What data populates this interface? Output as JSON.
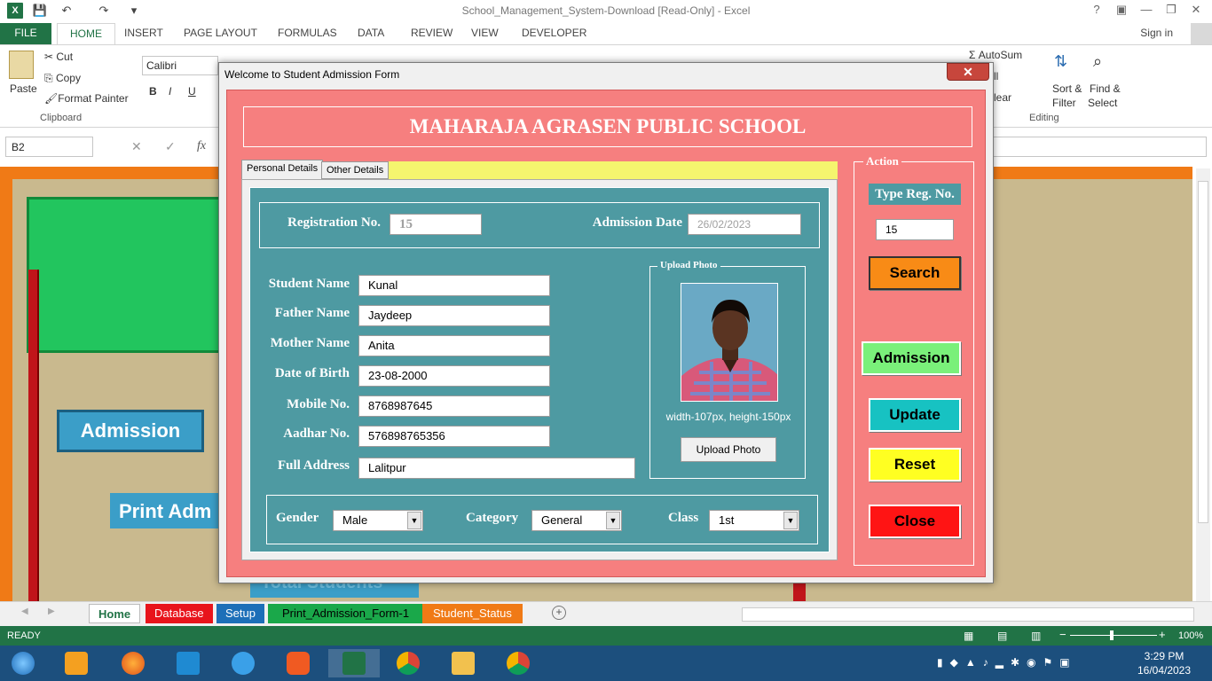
{
  "window": {
    "title": "School_Management_System-Download  [Read-Only] - Excel"
  },
  "ribbon_tabs": [
    "FILE",
    "HOME",
    "INSERT",
    "PAGE LAYOUT",
    "FORMULAS",
    "DATA",
    "REVIEW",
    "VIEW",
    "DEVELOPER"
  ],
  "account": {
    "sign_in": "Sign in"
  },
  "ribbon": {
    "paste": "Paste",
    "cut": "Cut",
    "copy": "Copy",
    "format_painter": "Format Painter",
    "clipboard": "Clipboard",
    "font_name": "Calibri",
    "bold": "B",
    "italic": "I",
    "underline": "U",
    "autosum": "AutoSum",
    "clear": "lear",
    "sort_filter": "Sort &",
    "sort_filter2": "Filter",
    "find_select": "Find &",
    "find_select2": "Select",
    "editing": "Editing",
    "fill": "ll"
  },
  "formula_bar": {
    "name_box": "B2",
    "fx": "fx"
  },
  "sheet": {
    "admission_button": "Admission",
    "print_admission_button": "Print Adm",
    "total_students": "Total Students"
  },
  "sheet_tabs": [
    {
      "label": "Home",
      "color": "#ffffff",
      "text_color": "#217346"
    },
    {
      "label": "Database",
      "color": "#e8141b",
      "text_color": "#ffffff"
    },
    {
      "label": "Setup",
      "color": "#1d6fb8",
      "text_color": "#ffffff"
    },
    {
      "label": "Print_Admission_Form-1",
      "color": "#1aa84a",
      "text_color": "#000000"
    },
    {
      "label": "Student_Status",
      "color": "#f07a16",
      "text_color": "#ffffff"
    }
  ],
  "status_bar": {
    "ready": "READY",
    "zoom": "100%"
  },
  "taskbar": {
    "time": "3:29 PM",
    "date": "16/04/2023"
  },
  "dialog": {
    "title": "Welcome to Student Admission Form",
    "close": "✕",
    "school_name": "MAHARAJA AGRASEN PUBLIC SCHOOL",
    "tabs": [
      "Personal Details",
      "Other Details"
    ],
    "registration_label": "Registration No.",
    "registration_value": "15",
    "admission_date_label": "Admission Date",
    "admission_date_value": "26/02/2023",
    "fields": {
      "student_name_label": "Student Name",
      "student_name": "Kunal",
      "father_name_label": "Father Name",
      "father_name": "Jaydeep",
      "mother_name_label": "Mother Name",
      "mother_name": "Anita",
      "dob_label": "Date of Birth",
      "dob": "23-08-2000",
      "mobile_label": "Mobile No.",
      "mobile": "8768987645",
      "aadhar_label": "Aadhar No.",
      "aadhar": "576898765356",
      "address_label": "Full Address",
      "address": "Lalitpur"
    },
    "photo": {
      "frame_label": "Upload Photo",
      "hint": "width-107px, height-150px",
      "button": "Upload Photo"
    },
    "gender_label": "Gender",
    "gender": "Male",
    "category_label": "Category",
    "category": "General",
    "class_label": "Class",
    "class": "1st",
    "action": {
      "frame_label": "Action",
      "type_reg_label": "Type Reg. No.",
      "type_reg_value": "15",
      "search": "Search",
      "admission": "Admission",
      "update": "Update",
      "reset": "Reset",
      "close": "Close"
    }
  }
}
